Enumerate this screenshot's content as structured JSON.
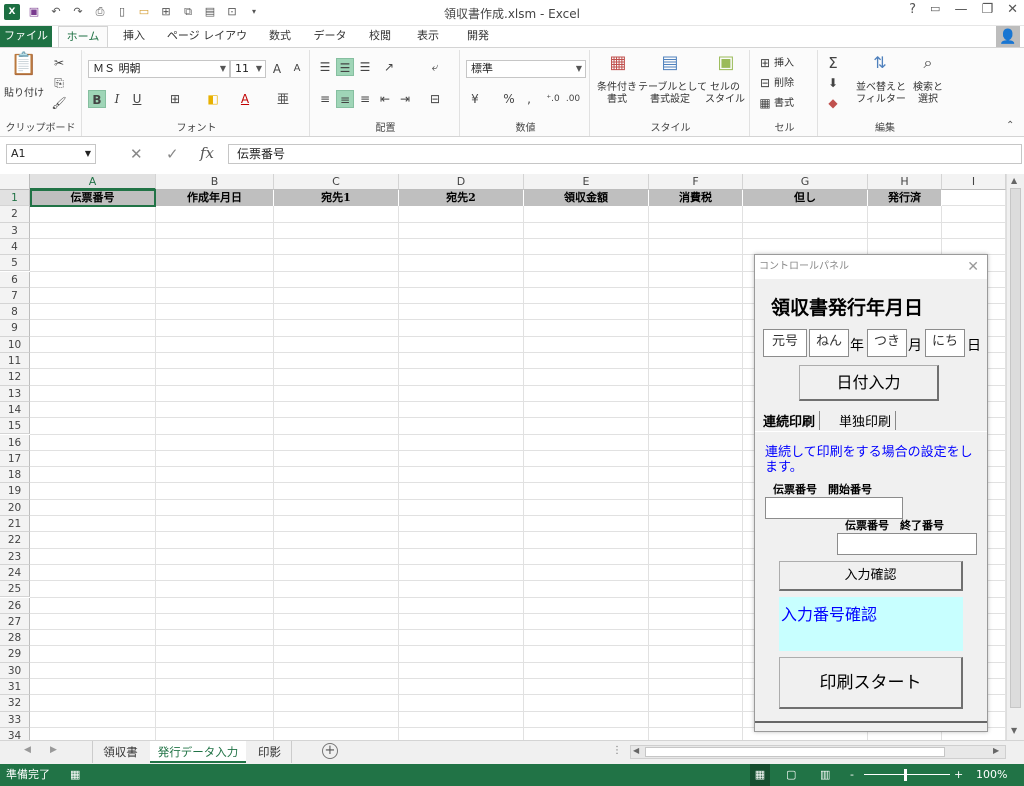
{
  "window": {
    "title": "領収書作成.xlsm - Excel",
    "help": "?",
    "min": "—",
    "restore": "❐",
    "close": "✕"
  },
  "qat": [
    "excel-logo-icon",
    "save-icon",
    "undo-icon",
    "redo-icon",
    "print-preview-icon",
    "new-icon",
    "open-icon",
    "form-icon",
    "copy-icon",
    "table-icon",
    "chart-icon",
    "customize-icon"
  ],
  "tabs": {
    "file": "ファイル",
    "items": [
      "ホーム",
      "挿入",
      "ページ レイアウト",
      "数式",
      "データ",
      "校閲",
      "表示",
      "開発"
    ],
    "active": "ホーム"
  },
  "ribbon": {
    "clipboard": {
      "paste": "貼り付け",
      "label": "クリップボード"
    },
    "font": {
      "name": "ＭＳ 明朝",
      "size": "11",
      "label": "フォント",
      "bold": "B",
      "italic": "I",
      "underline": "U",
      "grow": "A",
      "shrink": "A"
    },
    "align": {
      "label": "配置"
    },
    "number": {
      "format": "標準",
      "label": "数値",
      "percent": "%",
      "comma": ","
    },
    "style": {
      "cond": "条件付き\n書式",
      "table": "テーブルとして\n書式設定",
      "cell": "セルの\nスタイル",
      "label": "スタイル"
    },
    "cells": {
      "insert": "挿入",
      "delete": "削除",
      "format": "書式",
      "label": "セル"
    },
    "edit": {
      "sigma": "Σ",
      "sort": "並べ替えと\nフィルター",
      "find": "検索と\n選択",
      "label": "編集"
    }
  },
  "formula_bar": {
    "namebox": "A1",
    "fx": "fx",
    "content": "伝票番号"
  },
  "sheet": {
    "columns": [
      "A",
      "B",
      "C",
      "D",
      "E",
      "F",
      "G",
      "H",
      "I"
    ],
    "header_row": [
      "伝票番号",
      "作成年月日",
      "宛先1",
      "宛先2",
      "領収金額",
      "消費税",
      "但し",
      "発行済"
    ],
    "rows": [
      "1",
      "2",
      "3",
      "4",
      "5",
      "6",
      "7",
      "8",
      "9",
      "10",
      "11",
      "12",
      "13",
      "14",
      "15",
      "16",
      "17",
      "18",
      "19",
      "20",
      "21",
      "22",
      "23",
      "24",
      "25",
      "26",
      "27",
      "28",
      "29",
      "30",
      "31",
      "32",
      "33",
      "34"
    ]
  },
  "sheet_tabs": [
    "領収書",
    "発行データ入力",
    "印影"
  ],
  "active_sheet": "発行データ入力",
  "status": {
    "ready": "準備完了",
    "zoom": "100%",
    "minus": "-",
    "plus": "+"
  },
  "form": {
    "title": "コントロールパネル",
    "heading": "領収書発行年月日",
    "era": "元号",
    "year": "ねん",
    "year_suffix": "年",
    "month": "つき",
    "month_suffix": "月",
    "day": "にち",
    "day_suffix": "日",
    "date_button": "日付入力",
    "tab1": "連続印刷",
    "tab2": "単独印刷",
    "description": "連続して印刷をする場合の設定をします。",
    "start_label": "伝票番号　開始番号",
    "end_label": "伝票番号　終了番号",
    "confirm_button": "入力確認",
    "confirm_output": "入力番号確認",
    "print_button": "印刷スタート"
  },
  "colors": {
    "excel_green": "#217346",
    "header_fill": "#bfbfbf",
    "confirm_bg": "#c8ffff",
    "blue_text": "#0000ff"
  }
}
